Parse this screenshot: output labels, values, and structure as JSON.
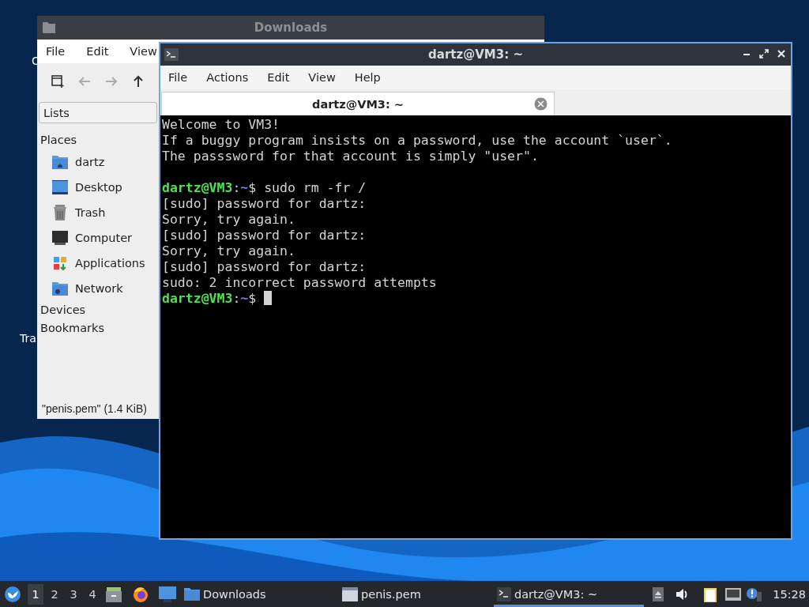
{
  "desktop": {
    "icon_labels": [
      "C",
      "Tra"
    ]
  },
  "file_manager": {
    "title": "Downloads",
    "menu": [
      "File",
      "Edit",
      "View"
    ],
    "toolbar": [
      {
        "kind": "new-tab",
        "disabled": false
      },
      {
        "kind": "back",
        "disabled": true
      },
      {
        "kind": "forward",
        "disabled": true
      },
      {
        "kind": "up",
        "disabled": false
      }
    ],
    "side_pane_mode": "Lists",
    "sections": [
      {
        "title": "Places",
        "items": [
          {
            "label": "dartz",
            "kind": "home"
          },
          {
            "label": "Desktop",
            "kind": "desktop"
          },
          {
            "label": "Trash",
            "kind": "trash"
          },
          {
            "label": "Computer",
            "kind": "computer"
          },
          {
            "label": "Applications",
            "kind": "applications"
          },
          {
            "label": "Network",
            "kind": "network"
          }
        ]
      },
      {
        "title": "Devices"
      },
      {
        "title": "Bookmarks"
      }
    ],
    "status": "\"penis.pem\" (1.4 KiB)"
  },
  "terminal": {
    "title": "dartz@VM3: ~",
    "menu": [
      "File",
      "Actions",
      "Edit",
      "View",
      "Help"
    ],
    "tabs": [
      {
        "label": "dartz@VM3: ~",
        "selected": true
      }
    ],
    "lines": [
      {
        "kind": "output",
        "text": "Welcome to VM3!"
      },
      {
        "kind": "output",
        "text": "If a buggy program insists on a password, use the account `user`."
      },
      {
        "kind": "output",
        "text": "The passsword for that account is simply \"user\"."
      },
      {
        "kind": "blank"
      },
      {
        "kind": "prompt",
        "host": "dartz@VM3",
        "sep": ":",
        "path": "~",
        "symbol": "$",
        "command": " sudo rm -fr /",
        "cursor": false
      },
      {
        "kind": "output",
        "text": "[sudo] password for dartz:"
      },
      {
        "kind": "output",
        "text": "Sorry, try again."
      },
      {
        "kind": "output",
        "text": "[sudo] password for dartz:"
      },
      {
        "kind": "output",
        "text": "Sorry, try again."
      },
      {
        "kind": "output",
        "text": "[sudo] password for dartz:"
      },
      {
        "kind": "output",
        "text": "sudo: 2 incorrect password attempts"
      },
      {
        "kind": "prompt",
        "host": "dartz@VM3",
        "sep": ":",
        "path": "~",
        "symbol": "$",
        "cursor": true
      }
    ]
  },
  "taskbar": {
    "desktops": [
      {
        "label": "1",
        "selected": true
      },
      {
        "label": "2",
        "selected": false
      },
      {
        "label": "3",
        "selected": false
      },
      {
        "label": "4",
        "selected": false
      }
    ],
    "tasks": [
      {
        "label": "Downloads",
        "kind": "folder",
        "selected": false
      },
      {
        "label": "penis.pem",
        "kind": "file",
        "selected": false
      },
      {
        "label": "dartz@VM3: ~",
        "kind": "terminal",
        "selected": true
      }
    ],
    "clock": "15:28"
  }
}
